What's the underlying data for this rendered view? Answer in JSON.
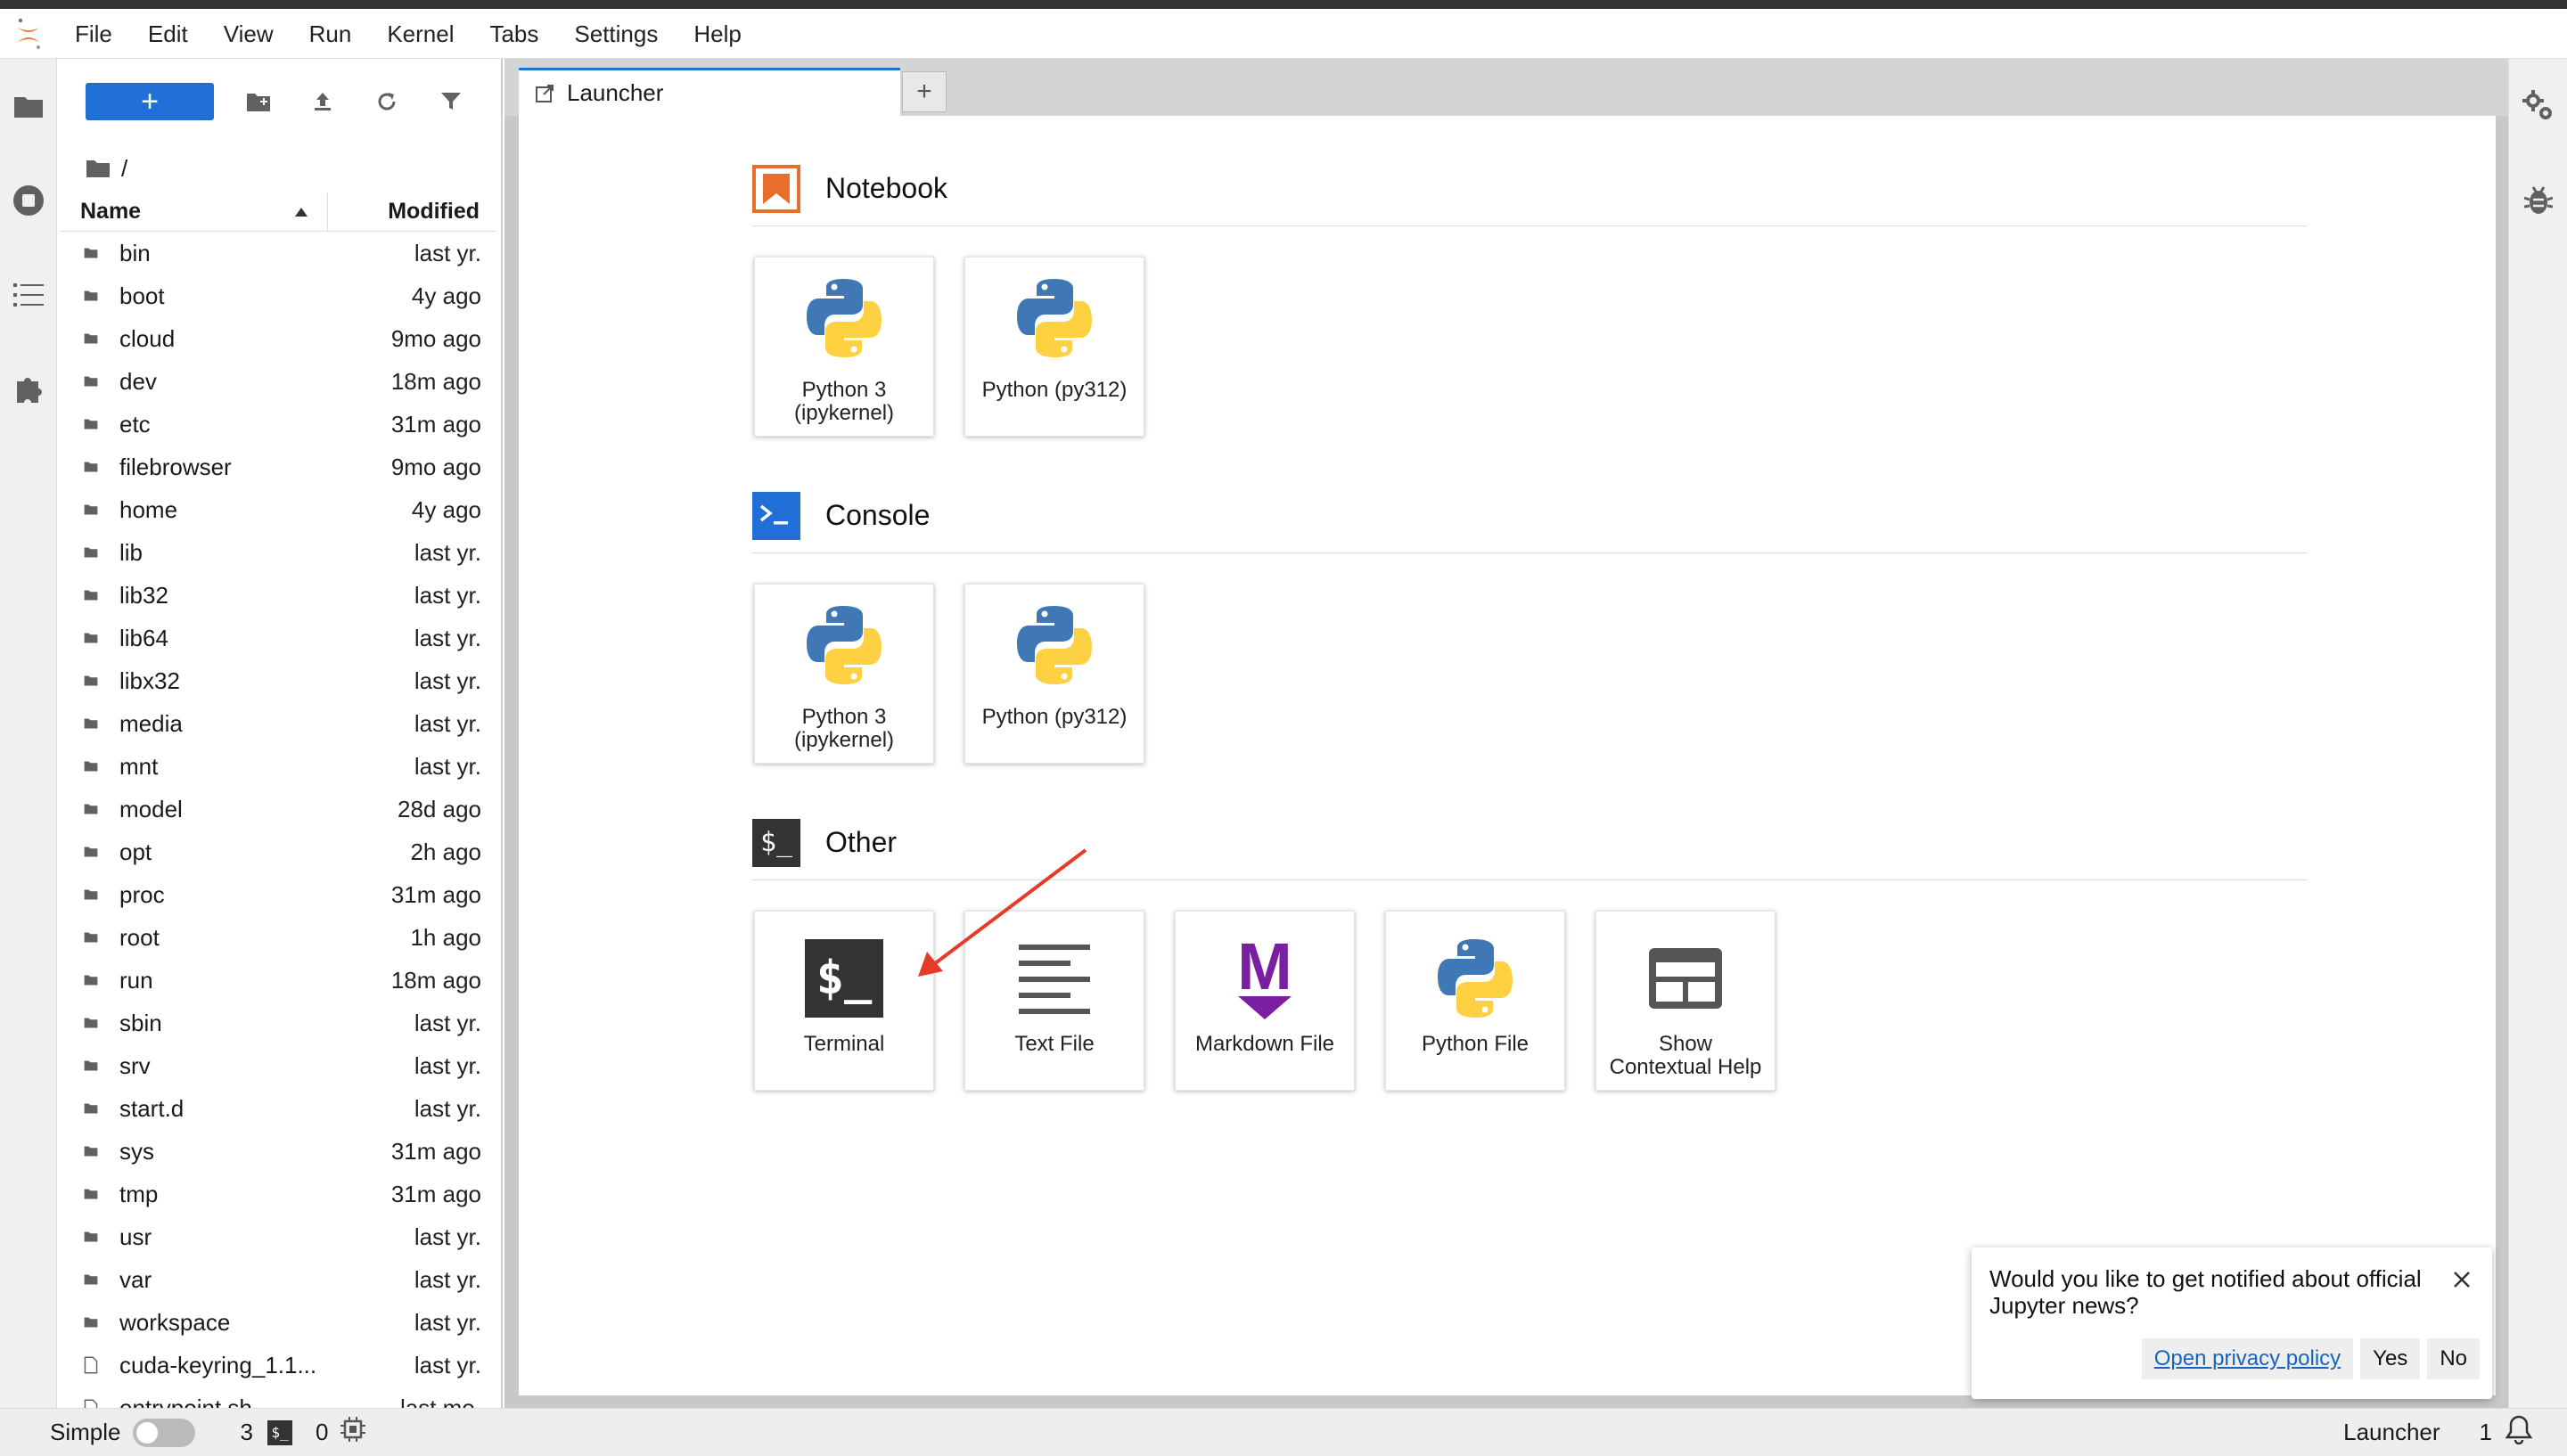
{
  "menu": [
    "File",
    "Edit",
    "View",
    "Run",
    "Kernel",
    "Tabs",
    "Settings",
    "Help"
  ],
  "filebrowser": {
    "new_label": "+",
    "breadcrumb": "/",
    "col_name": "Name",
    "col_modified": "Modified",
    "items": [
      {
        "name": "bin",
        "modified": "last yr.",
        "type": "folder"
      },
      {
        "name": "boot",
        "modified": "4y ago",
        "type": "folder"
      },
      {
        "name": "cloud",
        "modified": "9mo ago",
        "type": "folder"
      },
      {
        "name": "dev",
        "modified": "18m ago",
        "type": "folder"
      },
      {
        "name": "etc",
        "modified": "31m ago",
        "type": "folder"
      },
      {
        "name": "filebrowser",
        "modified": "9mo ago",
        "type": "folder"
      },
      {
        "name": "home",
        "modified": "4y ago",
        "type": "folder"
      },
      {
        "name": "lib",
        "modified": "last yr.",
        "type": "folder"
      },
      {
        "name": "lib32",
        "modified": "last yr.",
        "type": "folder"
      },
      {
        "name": "lib64",
        "modified": "last yr.",
        "type": "folder"
      },
      {
        "name": "libx32",
        "modified": "last yr.",
        "type": "folder"
      },
      {
        "name": "media",
        "modified": "last yr.",
        "type": "folder"
      },
      {
        "name": "mnt",
        "modified": "last yr.",
        "type": "folder"
      },
      {
        "name": "model",
        "modified": "28d ago",
        "type": "folder"
      },
      {
        "name": "opt",
        "modified": "2h ago",
        "type": "folder"
      },
      {
        "name": "proc",
        "modified": "31m ago",
        "type": "folder"
      },
      {
        "name": "root",
        "modified": "1h ago",
        "type": "folder"
      },
      {
        "name": "run",
        "modified": "18m ago",
        "type": "folder"
      },
      {
        "name": "sbin",
        "modified": "last yr.",
        "type": "folder"
      },
      {
        "name": "srv",
        "modified": "last yr.",
        "type": "folder"
      },
      {
        "name": "start.d",
        "modified": "last yr.",
        "type": "folder"
      },
      {
        "name": "sys",
        "modified": "31m ago",
        "type": "folder"
      },
      {
        "name": "tmp",
        "modified": "31m ago",
        "type": "folder"
      },
      {
        "name": "usr",
        "modified": "last yr.",
        "type": "folder"
      },
      {
        "name": "var",
        "modified": "last yr.",
        "type": "folder"
      },
      {
        "name": "workspace",
        "modified": "last yr.",
        "type": "folder"
      },
      {
        "name": "cuda-keyring_1.1...",
        "modified": "last yr.",
        "type": "file"
      },
      {
        "name": "entrypoint.sh",
        "modified": "last mo.",
        "type": "file"
      }
    ]
  },
  "tab": {
    "label": "Launcher",
    "add": "+"
  },
  "launcher": {
    "notebook": {
      "title": "Notebook",
      "cards": [
        {
          "label": "Python 3\n(ipykernel)"
        },
        {
          "label": "Python (py312)"
        }
      ]
    },
    "console": {
      "title": "Console",
      "cards": [
        {
          "label": "Python 3\n(ipykernel)"
        },
        {
          "label": "Python (py312)"
        }
      ]
    },
    "other": {
      "title": "Other",
      "cards": [
        {
          "label": "Terminal",
          "icon": "terminal-icon"
        },
        {
          "label": "Text File",
          "icon": "text-file-icon"
        },
        {
          "label": "Markdown File",
          "icon": "markdown-icon"
        },
        {
          "label": "Python File",
          "icon": "python-icon"
        },
        {
          "label": "Show\nContextual Help",
          "icon": "contextual-help-icon"
        }
      ]
    },
    "other_icon_text": "$_",
    "terminal_icon_text": "$_",
    "markdown_icon_text": "M"
  },
  "notification": {
    "message": "Would you like to get notified about official Jupyter news?",
    "privacy": "Open privacy policy",
    "yes": "Yes",
    "no": "No"
  },
  "status": {
    "mode": "Simple",
    "terminals": "3",
    "kernels": "0",
    "terminal_icon_text": "$_",
    "right_label": "Launcher",
    "right_count": "1"
  },
  "colors": {
    "accent": "#1976d2",
    "notebook": "#e86e2c",
    "console": "#1f6fd6",
    "markdown": "#7b1fa2",
    "arrow": "#e53b28"
  }
}
